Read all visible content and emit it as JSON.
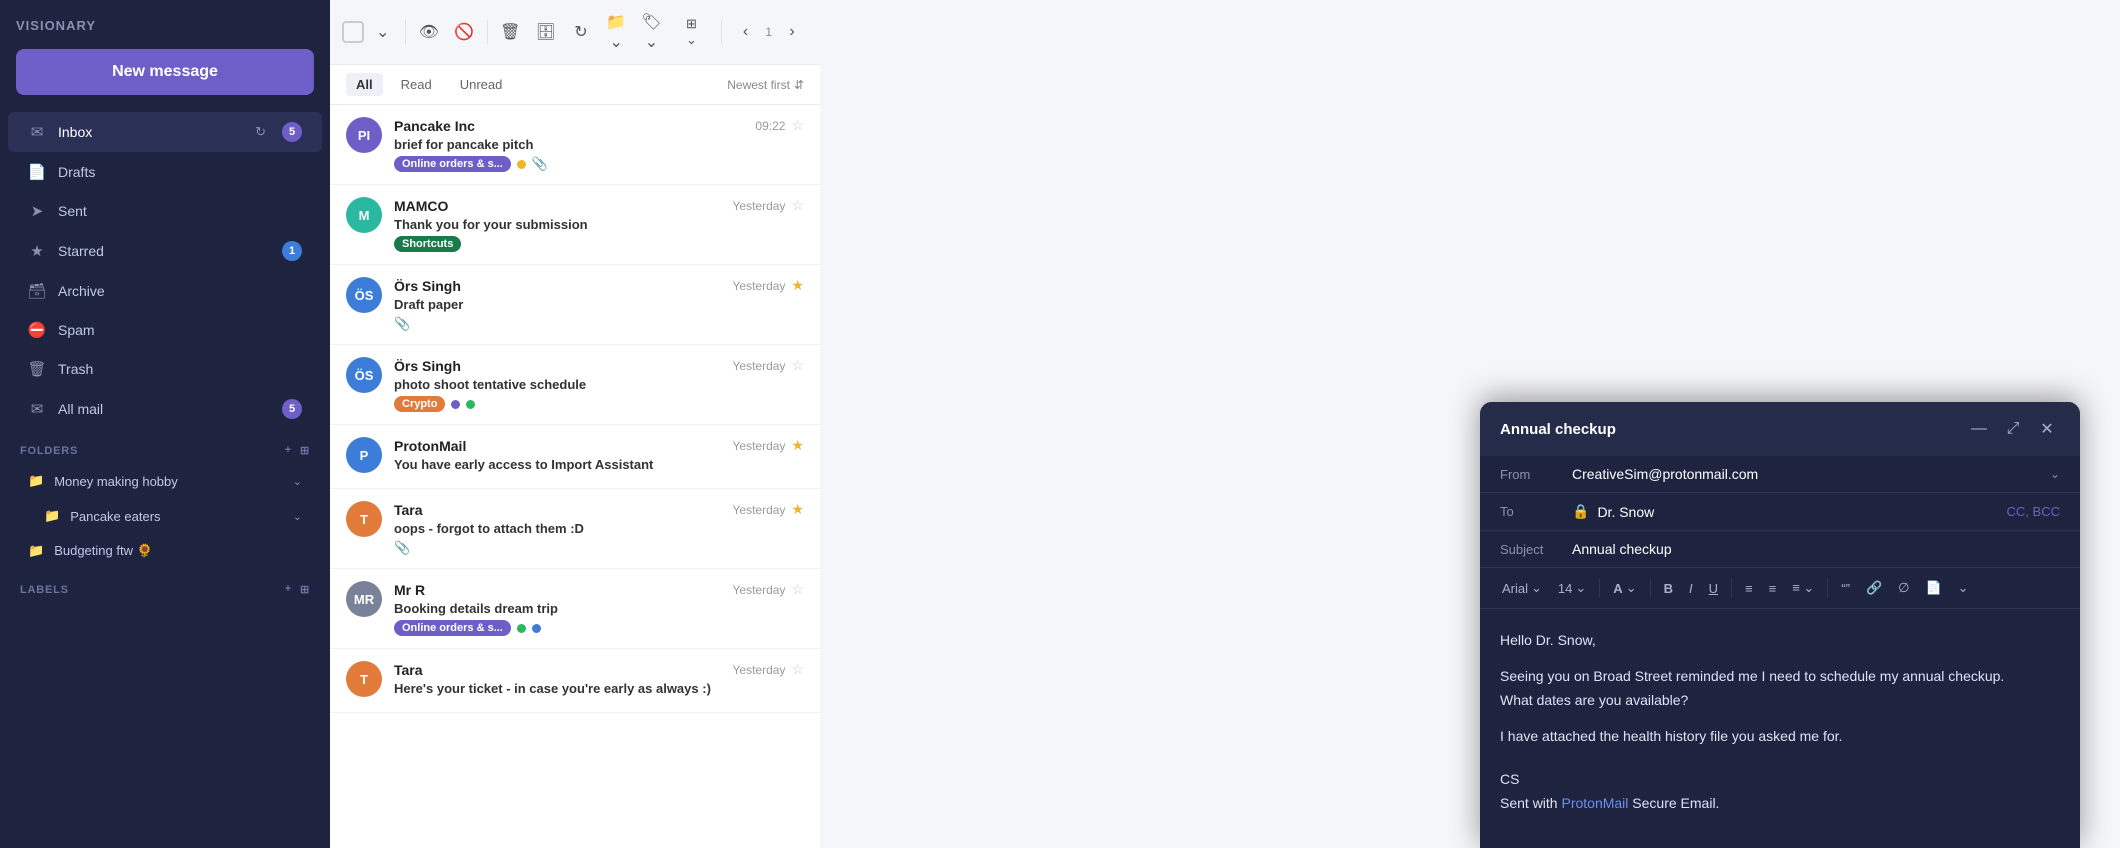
{
  "app": {
    "name": "VISIONARY"
  },
  "sidebar": {
    "new_message_label": "New message",
    "nav_items": [
      {
        "id": "inbox",
        "label": "Inbox",
        "icon": "inbox",
        "badge": "5",
        "badge_type": "purple",
        "refresh": true
      },
      {
        "id": "drafts",
        "label": "Drafts",
        "icon": "draft",
        "badge": null
      },
      {
        "id": "sent",
        "label": "Sent",
        "icon": "sent",
        "badge": null
      },
      {
        "id": "starred",
        "label": "Starred",
        "icon": "star",
        "badge": "1",
        "badge_type": "blue"
      },
      {
        "id": "archive",
        "label": "Archive",
        "icon": "archive",
        "badge": null
      },
      {
        "id": "spam",
        "label": "Spam",
        "icon": "spam",
        "badge": null
      },
      {
        "id": "trash",
        "label": "Trash",
        "icon": "trash",
        "badge": null
      },
      {
        "id": "all-mail",
        "label": "All mail",
        "icon": "mail",
        "badge": "5",
        "badge_type": "purple"
      }
    ],
    "folders_label": "FOLDERS",
    "folders": [
      {
        "id": "money-making-hobby",
        "label": "Money making hobby",
        "indent": 0,
        "chevron": true
      },
      {
        "id": "pancake-eaters",
        "label": "Pancake eaters",
        "indent": 1,
        "chevron": true
      },
      {
        "id": "budgeting-ftw",
        "label": "Budgeting ftw 🌻",
        "indent": 0,
        "chevron": false
      }
    ],
    "labels_label": "LABELS"
  },
  "email_list": {
    "toolbar": {
      "layout_icon": "⊞",
      "nav_prev": "‹",
      "nav_next": "›",
      "page_info": "1"
    },
    "filters": {
      "tabs": [
        "All",
        "Read",
        "Unread"
      ],
      "active": "All",
      "sort_label": "Newest first"
    },
    "emails": [
      {
        "id": 1,
        "from": "Pancake Inc",
        "avatar_initials": "PI",
        "avatar_color": "purple",
        "subject": "brief for pancake pitch",
        "preview": "",
        "time": "09:22",
        "starred": false,
        "tags": [
          {
            "label": "Online orders & s...",
            "type": "purple"
          }
        ],
        "dots": [
          {
            "color": "yellow"
          }
        ],
        "has_attachment": true
      },
      {
        "id": 2,
        "from": "MAMCO",
        "avatar_initials": "M",
        "avatar_color": "teal",
        "subject": "Thank you for your submission",
        "preview": "",
        "time": "Yesterday",
        "starred": false,
        "tags": [
          {
            "label": "Shortcuts",
            "type": "green"
          }
        ],
        "dots": [],
        "has_attachment": false
      },
      {
        "id": 3,
        "from": "Örs Singh",
        "avatar_initials": "ÖS",
        "avatar_color": "blue",
        "subject": "Draft paper",
        "preview": "",
        "time": "Yesterday",
        "starred": true,
        "tags": [],
        "dots": [],
        "has_attachment": true
      },
      {
        "id": 4,
        "from": "Örs Singh",
        "avatar_initials": "ÖS",
        "avatar_color": "blue",
        "subject": "photo shoot tentative schedule",
        "preview": "",
        "time": "Yesterday",
        "starred": false,
        "tags": [
          {
            "label": "Crypto",
            "type": "orange"
          }
        ],
        "dots": [
          {
            "color": "purple"
          },
          {
            "color": "green"
          }
        ],
        "has_attachment": false
      },
      {
        "id": 5,
        "from": "ProtonMail",
        "avatar_initials": "P",
        "avatar_color": "blue",
        "subject": "You have early access to Import Assistant",
        "preview": "",
        "time": "Yesterday",
        "starred": true,
        "tags": [],
        "dots": [],
        "has_attachment": false
      },
      {
        "id": 6,
        "from": "Tara",
        "avatar_initials": "T",
        "avatar_color": "orange",
        "subject": "oops - forgot to attach them :D",
        "preview": "",
        "time": "Yesterday",
        "starred": true,
        "tags": [],
        "dots": [],
        "has_attachment": true
      },
      {
        "id": 7,
        "from": "Mr R",
        "avatar_initials": "MR",
        "avatar_color": "gray",
        "subject": "Booking details dream trip",
        "preview": "",
        "time": "Yesterday",
        "starred": false,
        "tags": [
          {
            "label": "Online orders & s...",
            "type": "purple"
          }
        ],
        "dots": [
          {
            "color": "green"
          },
          {
            "color": "blue"
          }
        ],
        "has_attachment": false
      },
      {
        "id": 8,
        "from": "Tara",
        "avatar_initials": "T",
        "avatar_color": "orange",
        "subject": "Here's your ticket - in case you're early as always :)",
        "preview": "",
        "time": "Yesterday",
        "starred": false,
        "tags": [],
        "dots": [],
        "has_attachment": false
      }
    ]
  },
  "compose": {
    "title": "Annual checkup",
    "from_label": "From",
    "from_value": "CreativeSim@protonmail.com",
    "to_label": "To",
    "to_value": "Dr. Snow",
    "cc_bcc_label": "CC, BCC",
    "subject_label": "Subject",
    "subject_value": "Annual checkup",
    "toolbar": {
      "font": "Arial",
      "size": "14",
      "bold": "B",
      "italic": "I",
      "underline": "U",
      "align": "≡"
    },
    "body_lines": [
      "Hello Dr. Snow,",
      "",
      "Seeing you on Broad Street reminded me I need to schedule my annual checkup.",
      "What dates are you available?",
      "",
      "I have attached the health history file you asked me for.",
      "",
      "CS",
      "Sent with ProtonMail Secure Email."
    ],
    "protonmail_link_text": "ProtonMail",
    "minimize_btn": "—",
    "expand_btn": "⤢",
    "close_btn": "✕"
  }
}
